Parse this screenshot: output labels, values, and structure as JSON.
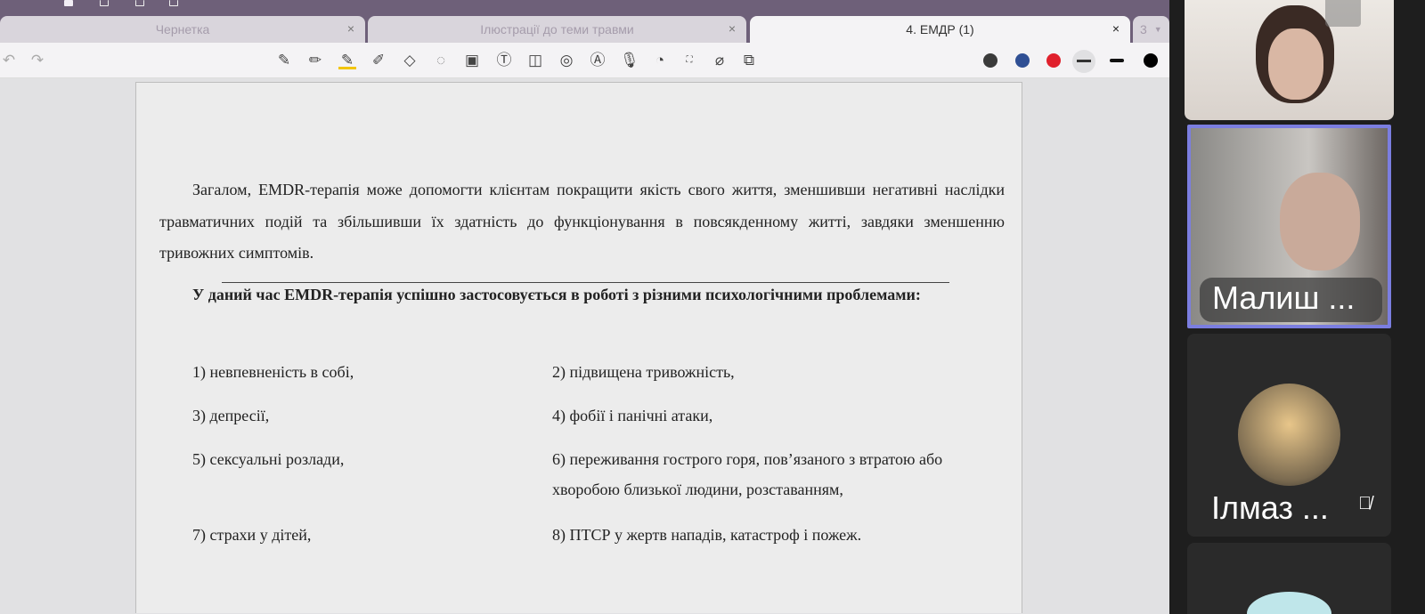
{
  "tabs": [
    {
      "label": "Чернетка"
    },
    {
      "label": "Ілюстрації до теми травми"
    },
    {
      "label": "4. ЕМДР (1)"
    },
    {
      "label": "3"
    }
  ],
  "tab_close": "×",
  "toolbar": {
    "tools": [
      "pen",
      "pencil",
      "highlighter",
      "marker",
      "eraser",
      "lasso",
      "image",
      "text",
      "shape",
      "tape",
      "text-recognition",
      "microphone",
      "sticker",
      "ocr",
      "laser",
      "translate"
    ],
    "colors": [
      "#3a3a3a",
      "#2f4f94",
      "#e0202c",
      "#333333",
      "#111111",
      "#000000"
    ]
  },
  "document": {
    "para1": "Загалом, EMDR-терапія може допомогти клієнтам покращити якість свого життя, зменшивши негативні наслідки травматичних подій та збільшивши їх здатність до функціонування в повсякденному житті, завдяки зменшенню тривожних симптомів.",
    "para2": "У даний час EMDR-терапія успішно застосовується в роботі з різними психологічними проблемами:",
    "items": [
      "1) невпевненість в собі,",
      "2) підвищена тривожність,",
      "3) депресії,",
      "4) фобії і панічні атаки,",
      "5) сексуальні розлади,",
      "6) переживання гострого горя, пов’язаного з втратою або хворобою близької людини, розставанням,",
      "7) страхи у дітей,",
      "8) ПТСР у жертв нападів, катастроф і пожеж."
    ]
  },
  "participants": [
    {
      "name": ""
    },
    {
      "name": "Малиш ..."
    },
    {
      "name": "Ілмаз ..."
    }
  ]
}
